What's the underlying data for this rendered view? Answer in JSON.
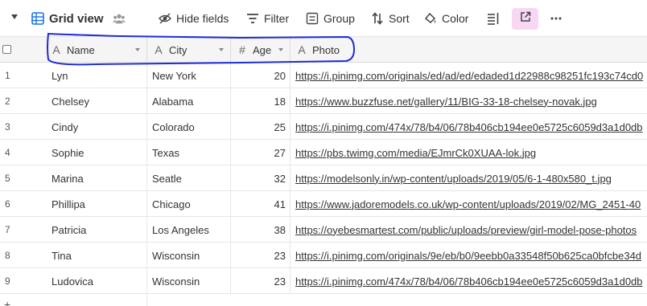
{
  "toolbar": {
    "view_name": "Grid view",
    "items": [
      {
        "label": "Hide fields",
        "icon": "hide-icon"
      },
      {
        "label": "Filter",
        "icon": "filter-icon"
      },
      {
        "label": "Group",
        "icon": "group-icon"
      },
      {
        "label": "Sort",
        "icon": "sort-icon"
      },
      {
        "label": "Color",
        "icon": "color-icon"
      }
    ],
    "accent_color": "#f8d7f3"
  },
  "columns": [
    {
      "label": "Name",
      "icon": "text-field-icon"
    },
    {
      "label": "City",
      "icon": "text-field-icon"
    },
    {
      "label": "Age",
      "icon": "number-field-icon"
    },
    {
      "label": "Photo",
      "icon": "text-field-icon"
    }
  ],
  "rows": [
    {
      "num": "1",
      "name": "Lyn",
      "city": "New York",
      "age": "20",
      "photo": "https://i.pinimg.com/originals/ed/ad/ed/edaded1d22988c98251fc193c74cd0"
    },
    {
      "num": "2",
      "name": "Chelsey",
      "city": "Alabama",
      "age": "18",
      "photo": "https://www.buzzfuse.net/gallery/11/BIG-33-18-chelsey-novak.jpg"
    },
    {
      "num": "3",
      "name": "Cindy",
      "city": "Colorado",
      "age": "25",
      "photo": "https://i.pinimg.com/474x/78/b4/06/78b406cb194ee0e5725c6059d3a1d0db"
    },
    {
      "num": "4",
      "name": "Sophie",
      "city": "Texas",
      "age": "27",
      "photo": "https://pbs.twimg.com/media/EJmrCk0XUAA-lok.jpg"
    },
    {
      "num": "5",
      "name": "Marina",
      "city": "Seatle",
      "age": "32",
      "photo": "https://modelsonly.in/wp-content/uploads/2019/05/6-1-480x580_t.jpg"
    },
    {
      "num": "6",
      "name": "Phillipa",
      "city": "Chicago",
      "age": "41",
      "photo": "https://www.jadoremodels.co.uk/wp-content/uploads/2019/02/MG_2451-40"
    },
    {
      "num": "7",
      "name": "Patricia",
      "city": "Los Angeles",
      "age": "38",
      "photo": "https://oyebesmartest.com/public/uploads/preview/girl-model-pose-photos"
    },
    {
      "num": "8",
      "name": "Tina",
      "city": "Wisconsin",
      "age": "23",
      "photo": "https://i.pinimg.com/originals/9e/eb/b0/9eebb0a33548f50b625ca0bfcbe34d"
    },
    {
      "num": "9",
      "name": "Ludovica",
      "city": "Wisconsin",
      "age": "23",
      "photo": "https://i.pinimg.com/474x/78/b4/06/78b406cb194ee0e5725c6059d3a1d0db"
    }
  ],
  "footer": {
    "add_symbol": "+"
  }
}
